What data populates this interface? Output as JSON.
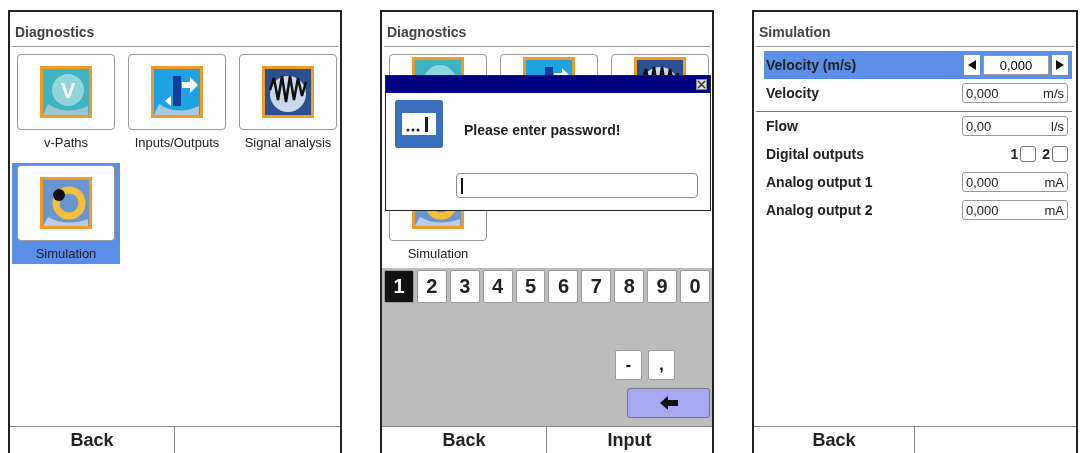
{
  "screens": [
    {
      "title": "Diagnostics",
      "tiles": [
        {
          "label": "v-Paths",
          "kind": "v",
          "glyph": "V",
          "selected": false
        },
        {
          "label": "Inputs/Outputs",
          "kind": "io",
          "selected": false
        },
        {
          "label": "Signal analysis",
          "kind": "signal",
          "selected": false
        },
        {
          "label": "Simulation",
          "kind": "simulation",
          "selected": true
        }
      ],
      "softkeys": [
        "Back"
      ]
    },
    {
      "title": "Diagnostics",
      "tiles": [
        {
          "kind": "v",
          "selected": false
        },
        {
          "kind": "io",
          "selected": false
        },
        {
          "kind": "signal",
          "selected": false
        },
        {
          "label": "Simulation",
          "kind": "simulation",
          "selected": false
        }
      ],
      "dialog": {
        "message": "Please enter password!"
      },
      "keypad": {
        "keys": [
          {
            "key": "1",
            "selected": true
          },
          {
            "key": "2",
            "selected": false
          },
          {
            "key": "3",
            "selected": false
          },
          {
            "key": "4",
            "selected": false
          },
          {
            "key": "5",
            "selected": false
          },
          {
            "key": "6",
            "selected": false
          },
          {
            "key": "7",
            "selected": false
          },
          {
            "key": "8",
            "selected": false
          },
          {
            "key": "9",
            "selected": false
          },
          {
            "key": "0",
            "selected": false
          }
        ],
        "extra": [
          "-",
          ","
        ]
      },
      "softkeys": [
        "Back",
        "Input"
      ]
    },
    {
      "title": "Simulation",
      "rows": [
        {
          "kind": "spinner",
          "label": "Velocity (m/s)",
          "value": "0,000",
          "selected": true
        },
        {
          "kind": "field",
          "label": "Velocity",
          "value": "0,000",
          "unit": "m/s",
          "selected": false
        },
        {
          "kind": "field",
          "label": "Flow",
          "value": "0,00",
          "unit": "l/s",
          "selected": false,
          "separator": true
        },
        {
          "kind": "checks",
          "label": "Digital outputs",
          "checks": [
            {
              "label": "1",
              "checked": false
            },
            {
              "label": "2",
              "checked": false
            }
          ],
          "selected": false
        },
        {
          "kind": "field",
          "label": "Analog output 1",
          "value": "0,000",
          "unit": "mA",
          "selected": false
        },
        {
          "kind": "field",
          "label": "Analog output 2",
          "value": "0,000",
          "unit": "mA",
          "selected": false
        }
      ],
      "softkeys": [
        "Back"
      ]
    }
  ]
}
